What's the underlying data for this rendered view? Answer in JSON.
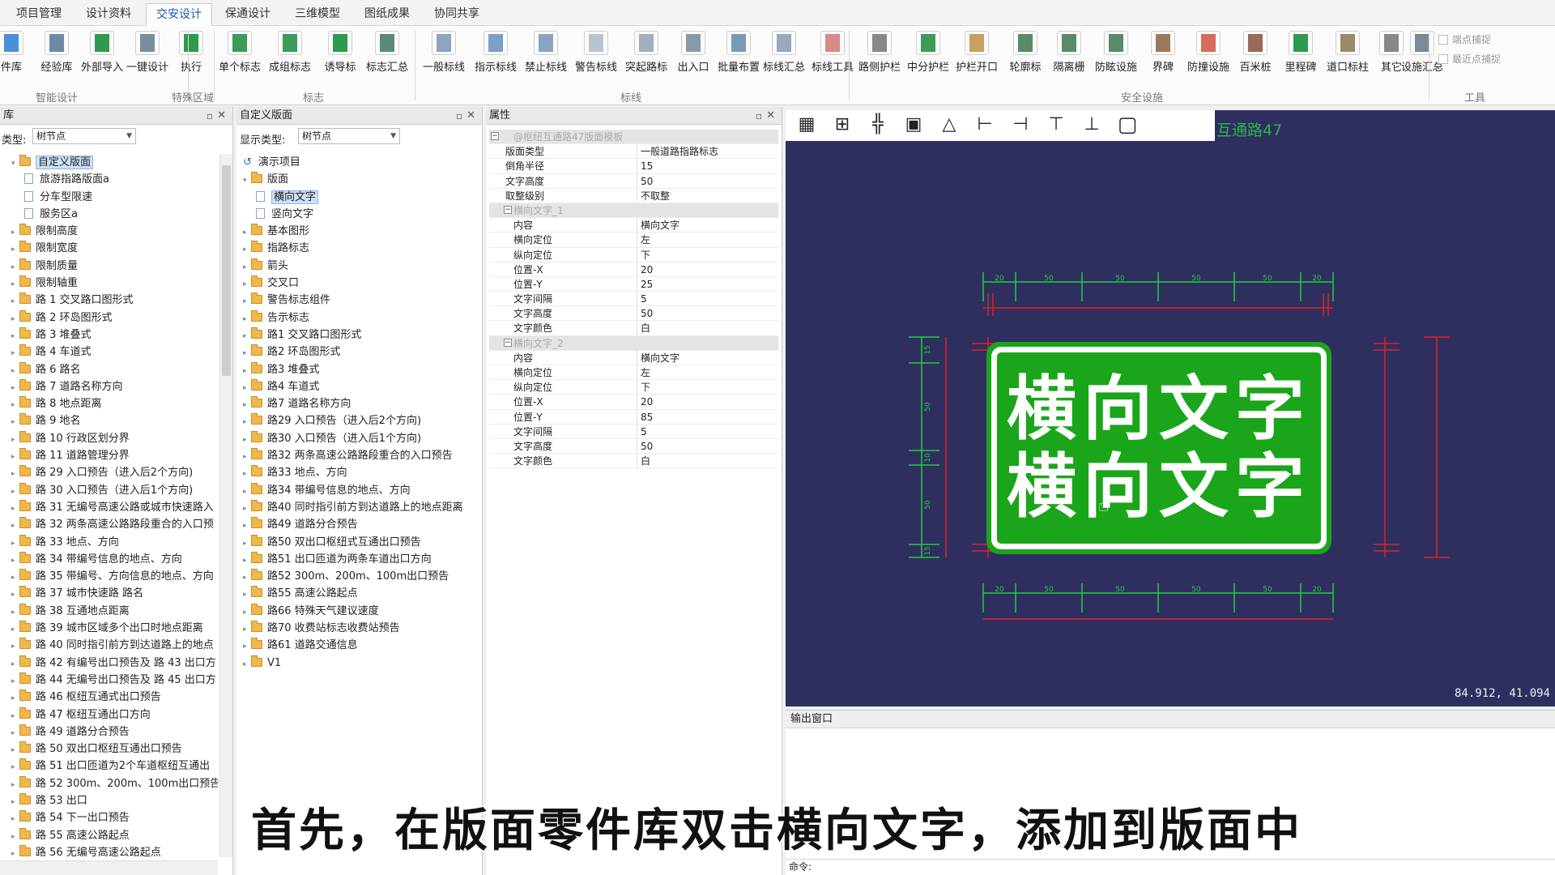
{
  "menu": {
    "tabs": [
      {
        "label": "项目管理"
      },
      {
        "label": "设计资料"
      },
      {
        "label": "交安设计"
      },
      {
        "label": "保通设计"
      },
      {
        "label": "三维模型"
      },
      {
        "label": "图纸成果"
      },
      {
        "label": "协同共享"
      }
    ]
  },
  "ribbon": {
    "buttons": [
      {
        "label": "件库",
        "icon": "parts-library-icon"
      },
      {
        "label": "经验库",
        "icon": "experience-library-icon"
      },
      {
        "label": "外部导入",
        "icon": "xls-import-icon"
      },
      {
        "label": "一键设计",
        "icon": "one-click-design-icon"
      },
      {
        "label": "执行",
        "icon": "execute-icon"
      },
      {
        "label": "单个标志",
        "icon": "single-sign-icon"
      },
      {
        "label": "成组标志",
        "icon": "group-sign-icon"
      },
      {
        "label": "诱导标",
        "icon": "guide-sign-icon"
      },
      {
        "label": "标志汇总",
        "icon": "sign-summary-icon"
      },
      {
        "label": "一般标线",
        "icon": "general-marking-icon"
      },
      {
        "label": "指示标线",
        "icon": "indicator-marking-icon"
      },
      {
        "label": "禁止标线",
        "icon": "prohibition-marking-icon"
      },
      {
        "label": "警告标线",
        "icon": "warning-marking-icon"
      },
      {
        "label": "突起路标",
        "icon": "raised-marker-icon"
      },
      {
        "label": "出入口",
        "icon": "entrance-exit-icon"
      },
      {
        "label": "批量布置",
        "icon": "batch-layout-icon"
      },
      {
        "label": "标线汇总",
        "icon": "marking-summary-icon"
      },
      {
        "label": "标线工具",
        "icon": "marking-tools-icon"
      },
      {
        "label": "路侧护栏",
        "icon": "roadside-guardrail-icon"
      },
      {
        "label": "中分护栏",
        "icon": "median-guardrail-icon"
      },
      {
        "label": "护栏开口",
        "icon": "guardrail-opening-icon"
      },
      {
        "label": "轮廓标",
        "icon": "delineator-icon"
      },
      {
        "label": "隔离栅",
        "icon": "fence-icon"
      },
      {
        "label": "防眩设施",
        "icon": "anti-glare-icon"
      },
      {
        "label": "界碑",
        "icon": "boundary-marker-icon"
      },
      {
        "label": "防撞设施",
        "icon": "anti-collision-icon"
      },
      {
        "label": "百米桩",
        "icon": "hundred-meter-post-icon"
      },
      {
        "label": "里程碑",
        "icon": "milestone-icon"
      },
      {
        "label": "道口标柱",
        "icon": "crossing-post-icon"
      },
      {
        "label": "其它",
        "icon": "more-icon"
      },
      {
        "label": "设施汇总",
        "icon": "facility-summary-icon"
      }
    ],
    "groups": {
      "smart": "智能设计",
      "special": "特殊区域",
      "sign": "标志",
      "marking": "标线",
      "safety": "安全设施",
      "tools": "工具"
    },
    "checkboxes": {
      "endpoint_snap": "端点捕捉",
      "nearest_snap": "最近点捕捉"
    }
  },
  "library_panel": {
    "title": "库",
    "filter_label": "类型:",
    "filter_value": "树节点",
    "items": [
      {
        "label": "自定义版面",
        "kind": "folder",
        "selected": true
      },
      {
        "label": "旅游指路版面a",
        "kind": "doc"
      },
      {
        "label": "分车型限速",
        "kind": "doc"
      },
      {
        "label": "服务区a",
        "kind": "doc"
      },
      {
        "label": "限制高度",
        "kind": "folder"
      },
      {
        "label": "限制宽度",
        "kind": "folder"
      },
      {
        "label": "限制质量",
        "kind": "folder"
      },
      {
        "label": "限制轴重",
        "kind": "folder"
      },
      {
        "label": "路 1 交叉路口图形式",
        "kind": "folder"
      },
      {
        "label": "路 2 环岛图形式",
        "kind": "folder"
      },
      {
        "label": "路 3 堆叠式",
        "kind": "folder"
      },
      {
        "label": "路 4 车道式",
        "kind": "folder"
      },
      {
        "label": "路 6 路名",
        "kind": "folder"
      },
      {
        "label": "路 7 道路名称方向",
        "kind": "folder"
      },
      {
        "label": "路 8 地点距离",
        "kind": "folder"
      },
      {
        "label": "路 9 地名",
        "kind": "folder"
      },
      {
        "label": "路 10 行政区划分界",
        "kind": "folder"
      },
      {
        "label": "路 11 道路管理分界",
        "kind": "folder"
      },
      {
        "label": "路 29 入口预告（进入后2个方向)",
        "kind": "folder"
      },
      {
        "label": "路 30 入口预告（进入后1个方向)",
        "kind": "folder"
      },
      {
        "label": "路 31 无编号高速公路或城市快速路入",
        "kind": "folder"
      },
      {
        "label": "路 32 两条高速公路路段重合的入口预",
        "kind": "folder"
      },
      {
        "label": "路 33 地点、方向",
        "kind": "folder"
      },
      {
        "label": "路 34 带编号信息的地点、方向",
        "kind": "folder"
      },
      {
        "label": "路 35 带编号、方向信息的地点、方向",
        "kind": "folder"
      },
      {
        "label": "路 37 城市快速路 路名",
        "kind": "folder"
      },
      {
        "label": "路 38 互通地点距离",
        "kind": "folder"
      },
      {
        "label": "路 39 城市区域多个出口时地点距离",
        "kind": "folder"
      },
      {
        "label": "路 40 同时指引前方到达道路上的地点",
        "kind": "folder"
      },
      {
        "label": "路 42 有编号出口预告及 路 43 出口方",
        "kind": "folder"
      },
      {
        "label": "路 44 无编号出口预告及 路 45 出口方",
        "kind": "folder"
      },
      {
        "label": "路 46 枢纽互通式出口预告",
        "kind": "folder"
      },
      {
        "label": "路 47 枢纽互通出口方向",
        "kind": "folder"
      },
      {
        "label": "路 49 道路分合预告",
        "kind": "folder"
      },
      {
        "label": "路 50 双出口枢纽互通出口预告",
        "kind": "folder"
      },
      {
        "label": "路 51 出口匝道为2个车道枢纽互通出",
        "kind": "folder"
      },
      {
        "label": "路 52 300m、200m、100m出口预告",
        "kind": "folder"
      },
      {
        "label": "路 53 出口",
        "kind": "folder"
      },
      {
        "label": "路 54 下一出口预告",
        "kind": "folder"
      },
      {
        "label": "路 55 高速公路起点",
        "kind": "folder"
      },
      {
        "label": "路 56 无编号高速公路起点",
        "kind": "folder"
      }
    ]
  },
  "custom_panel": {
    "title": "自定义版面",
    "filter_label": "显示类型:",
    "filter_value": "树节点",
    "root": "演示项目",
    "items": [
      {
        "label": "版面",
        "kind": "folder",
        "level": 1
      },
      {
        "label": "横向文字",
        "kind": "doc",
        "level": 2,
        "selected": true
      },
      {
        "label": "竖向文字",
        "kind": "doc",
        "level": 2
      },
      {
        "label": "基本图形",
        "kind": "folder",
        "level": 1
      },
      {
        "label": "指路标志",
        "kind": "folder",
        "level": 1
      },
      {
        "label": "箭头",
        "kind": "folder",
        "level": 1
      },
      {
        "label": "交叉口",
        "kind": "folder",
        "level": 1
      },
      {
        "label": "警告标志组件",
        "kind": "folder",
        "level": 1
      },
      {
        "label": "告示标志",
        "kind": "folder",
        "level": 1
      },
      {
        "label": "路1 交叉路口图形式",
        "kind": "folder",
        "level": 1
      },
      {
        "label": "路2 环岛图形式",
        "kind": "folder",
        "level": 1
      },
      {
        "label": "路3 堆叠式",
        "kind": "folder",
        "level": 1
      },
      {
        "label": "路4 车道式",
        "kind": "folder",
        "level": 1
      },
      {
        "label": "路7 道路名称方向",
        "kind": "folder",
        "level": 1
      },
      {
        "label": "路29 入口预告（进入后2个方向)",
        "kind": "folder",
        "level": 1
      },
      {
        "label": "路30 入口预告（进入后1个方向)",
        "kind": "folder",
        "level": 1
      },
      {
        "label": "路32 两条高速公路路段重合的入口预告",
        "kind": "folder",
        "level": 1
      },
      {
        "label": "路33 地点、方向",
        "kind": "folder",
        "level": 1
      },
      {
        "label": "路34 带编号信息的地点、方向",
        "kind": "folder",
        "level": 1
      },
      {
        "label": "路40 同时指引前方到达道路上的地点距离",
        "kind": "folder",
        "level": 1
      },
      {
        "label": "路49 道路分合预告",
        "kind": "folder",
        "level": 1
      },
      {
        "label": "路50 双出口枢纽式互通出口预告",
        "kind": "folder",
        "level": 1
      },
      {
        "label": "路51 出口匝道为两条车道出口方向",
        "kind": "folder",
        "level": 1
      },
      {
        "label": "路52 300m、200m、100m出口预告",
        "kind": "folder",
        "level": 1
      },
      {
        "label": "路55 高速公路起点",
        "kind": "folder",
        "level": 1
      },
      {
        "label": "路66 特殊天气建议速度",
        "kind": "folder",
        "level": 1
      },
      {
        "label": "路70 收费站标志收费站预告",
        "kind": "folder",
        "level": 1
      },
      {
        "label": "路61 道路交通信息",
        "kind": "folder",
        "level": 1
      },
      {
        "label": "V1",
        "kind": "folder",
        "level": 1
      }
    ]
  },
  "props_panel": {
    "title": "属性",
    "rows": [
      {
        "type": "group",
        "k": "@枢纽互通路47版面模板",
        "level": 0
      },
      {
        "type": "row",
        "k": "版面类型",
        "v": "一般道路指路标志"
      },
      {
        "type": "row",
        "k": "倒角半径",
        "v": "15"
      },
      {
        "type": "row",
        "k": "文字高度",
        "v": "50"
      },
      {
        "type": "row",
        "k": "取整级别",
        "v": "不取整"
      },
      {
        "type": "group",
        "k": "横向文字_1",
        "level": 1
      },
      {
        "type": "row",
        "k": "内容",
        "v": "横向文字",
        "indent": true
      },
      {
        "type": "row",
        "k": "横向定位",
        "v": "左",
        "indent": true
      },
      {
        "type": "row",
        "k": "纵向定位",
        "v": "下",
        "indent": true
      },
      {
        "type": "row",
        "k": "位置-X",
        "v": "20",
        "indent": true
      },
      {
        "type": "row",
        "k": "位置-Y",
        "v": "25",
        "indent": true
      },
      {
        "type": "row",
        "k": "文字间隔",
        "v": "5",
        "indent": true
      },
      {
        "type": "row",
        "k": "文字高度",
        "v": "50",
        "indent": true
      },
      {
        "type": "row",
        "k": "文字颜色",
        "v": "白",
        "indent": true
      },
      {
        "type": "group",
        "k": "横向文字_2",
        "level": 1
      },
      {
        "type": "row",
        "k": "内容",
        "v": "横向文字",
        "indent": true
      },
      {
        "type": "row",
        "k": "横向定位",
        "v": "左",
        "indent": true
      },
      {
        "type": "row",
        "k": "纵向定位",
        "v": "下",
        "indent": true
      },
      {
        "type": "row",
        "k": "位置-X",
        "v": "20",
        "indent": true
      },
      {
        "type": "row",
        "k": "位置-Y",
        "v": "85",
        "indent": true
      },
      {
        "type": "row",
        "k": "文字间隔",
        "v": "5",
        "indent": true
      },
      {
        "type": "row",
        "k": "文字高度",
        "v": "50",
        "indent": true
      },
      {
        "type": "row",
        "k": "文字颜色",
        "v": "白",
        "indent": true
      }
    ]
  },
  "canvas": {
    "title": "互通路47",
    "coords": "84.912, 41.094",
    "sign_line_1": "横向文字",
    "sign_line_2": "横向文字",
    "dim_top": [
      "20",
      "50",
      "50",
      "50",
      "50",
      "20"
    ],
    "dim_left": [
      "15",
      "50",
      "10",
      "50",
      "15"
    ],
    "colors": {
      "background": "#2e2f5e",
      "sign_green": "#1aa51a",
      "dimension_red": "#e02222",
      "dimension_green": "#22cc44"
    }
  },
  "output": {
    "title": "输出窗口",
    "cmd_label": "命令:"
  },
  "subtitle": "首先，在版面零件库双击横向文字，添加到版面中"
}
